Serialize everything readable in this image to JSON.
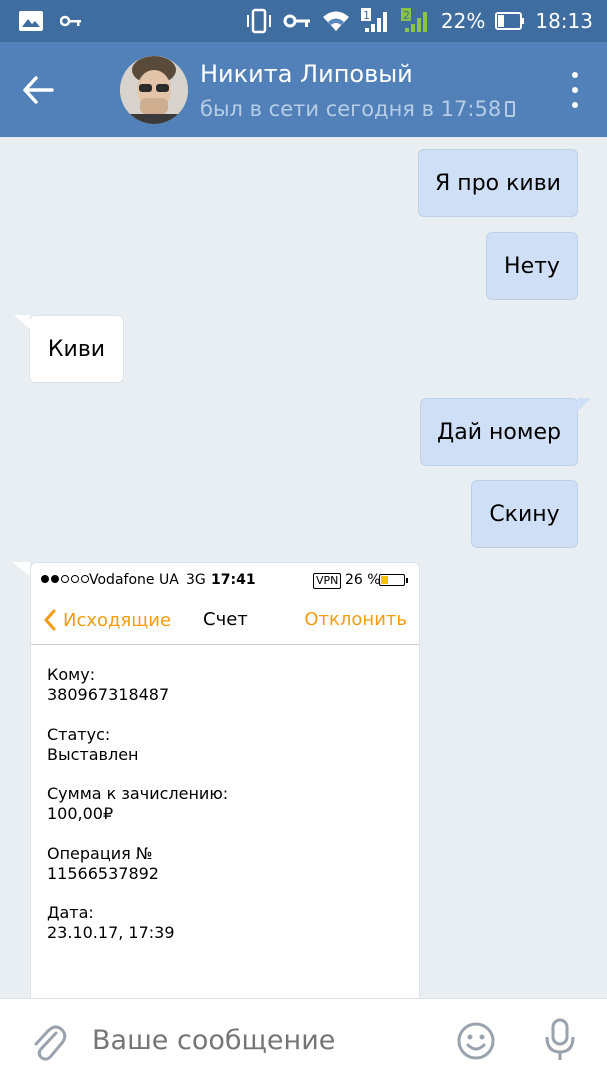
{
  "status_bar": {
    "battery_percent": "22%",
    "time": "18:13",
    "sim1": "1",
    "sim2": "2"
  },
  "header": {
    "contact_name": "Никита Липовый",
    "contact_status": "был в сети сегодня в 17:58"
  },
  "messages": [
    {
      "dir": "out",
      "text": "Я про киви"
    },
    {
      "dir": "out",
      "text": "Нету"
    },
    {
      "dir": "in",
      "text": "Киви"
    },
    {
      "dir": "out",
      "text": "Дай номер"
    },
    {
      "dir": "out",
      "text": "Скину"
    }
  ],
  "screenshot": {
    "carrier": "Vodafone UA",
    "network": "3G",
    "time": "17:41",
    "vpn": "VPN",
    "battery": "26 %",
    "back_label": "Исходящие",
    "title": "Счет",
    "decline_label": "Отклонить",
    "fields": [
      {
        "label": "Кому:",
        "value": "380967318487"
      },
      {
        "label": "Статус:",
        "value": "Выставлен"
      },
      {
        "label": "Сумма к зачислению:",
        "value": "100,00₽"
      },
      {
        "label": "Операция №",
        "value": "11566537892"
      },
      {
        "label": "Дата:",
        "value": "23.10.17, 17:39"
      }
    ]
  },
  "composer": {
    "placeholder": "Ваше сообщение"
  },
  "colors": {
    "status_bar": "#3f6da0",
    "app_bar": "#5181b8",
    "chat_bg": "#e9eef2",
    "outgoing_bubble": "#cfdff5",
    "incoming_bubble": "#ffffff",
    "ios_accent": "#f39c12"
  }
}
